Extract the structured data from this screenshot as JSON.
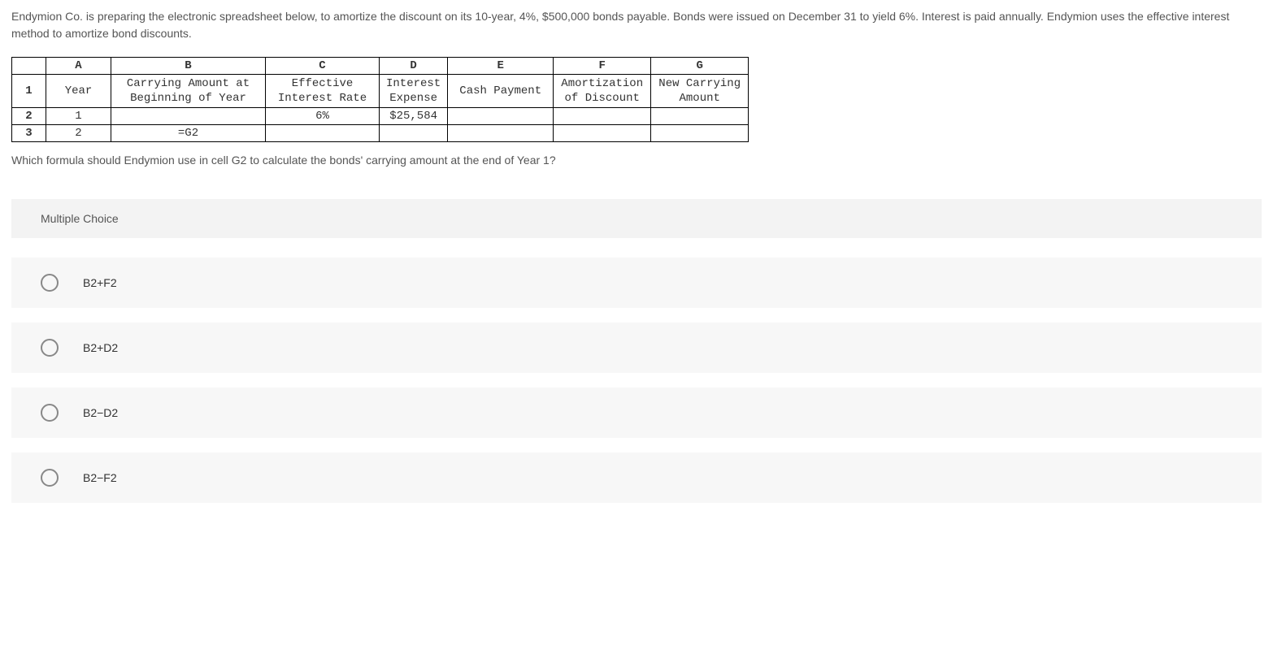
{
  "question": {
    "intro": "Endymion Co. is preparing the electronic spreadsheet below, to amortize the discount on its 10-year, 4%, $500,000 bonds payable. Bonds were issued on December 31 to yield 6%. Interest is paid annually. Endymion uses the effective interest method to amortize bond discounts.",
    "followup": "Which formula should Endymion use in cell G2 to calculate the bonds' carrying amount at the end of Year 1?"
  },
  "spreadsheet": {
    "col_letters": {
      "a": "A",
      "b": "B",
      "c": "C",
      "d": "D",
      "e": "E",
      "f": "F",
      "g": "G"
    },
    "headers_row1": {
      "num": "1",
      "a": "Year",
      "b_line1": "Carrying Amount at",
      "b_line2": "Beginning of Year",
      "c_line1": "Effective",
      "c_line2": "Interest Rate",
      "d_line1": "Interest",
      "d_line2": "Expense",
      "e": "Cash Payment",
      "f_line1": "Amortization",
      "f_line2": "of Discount",
      "g_line1": "New Carrying",
      "g_line2": "Amount"
    },
    "row2": {
      "num": "2",
      "a": "1",
      "b": "",
      "c": "6%",
      "d": "$25,584",
      "e": "",
      "f": "",
      "g": ""
    },
    "row3": {
      "num": "3",
      "a": "2",
      "b": "=G2",
      "c": "",
      "d": "",
      "e": "",
      "f": "",
      "g": ""
    }
  },
  "mc_heading": "Multiple Choice",
  "choices": {
    "c1": "B2+F2",
    "c2": "B2+D2",
    "c3": "B2−D2",
    "c4": "B2−F2"
  }
}
